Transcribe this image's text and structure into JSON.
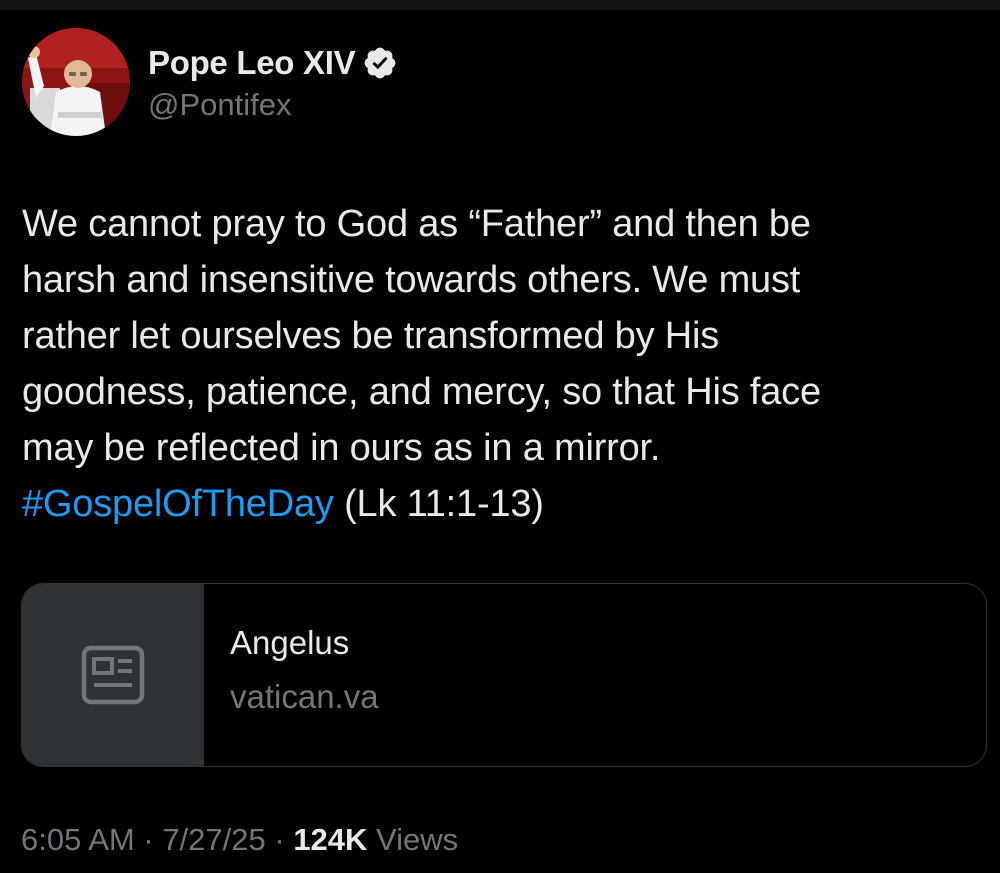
{
  "author": {
    "display_name": "Pope Leo XIV",
    "handle": "@Pontifex",
    "verified": true,
    "avatar_icon": "profile-photo"
  },
  "tweet": {
    "text": "We cannot pray to God as “Father” and then be\nharsh and insensitive towards others. We must\nrather let ourselves be transformed by His\ngoodness, patience, and mercy, so that His face\nmay be reflected in ours as in a mirror.\n",
    "hashtag": "#GospelOfTheDay",
    "reference": " (Lk 11:1-13)"
  },
  "link_card": {
    "icon": "article-icon",
    "title": "Angelus",
    "domain": "vatican.va"
  },
  "meta": {
    "time": "6:05 AM",
    "sep1": " · ",
    "date": "7/27/25",
    "sep2": " · ",
    "views_count": "124K",
    "views_label": " Views"
  },
  "colors": {
    "background": "#000000",
    "text": "#e7e9ea",
    "muted": "#71767b",
    "accent": "#1d9bf0",
    "border": "#2f3336"
  }
}
